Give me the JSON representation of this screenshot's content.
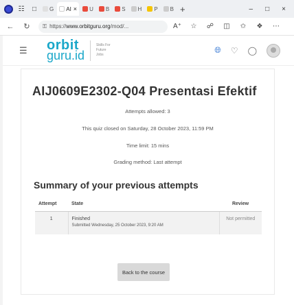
{
  "browser": {
    "tabs": [
      {
        "label": "G",
        "fav_color": "#e0e0e0"
      },
      {
        "label": "AΙ",
        "fav_color": "#ffffff",
        "active": true
      },
      {
        "label": "U",
        "fav_color": "#e94b3c"
      },
      {
        "label": "B",
        "fav_color": "#e94b3c"
      },
      {
        "label": "S",
        "fav_color": "#e94b3c"
      },
      {
        "label": "H",
        "fav_color": "#cccccc"
      },
      {
        "label": "P",
        "fav_color": "#f5c400"
      },
      {
        "label": "B",
        "fav_color": "#cccccc"
      }
    ],
    "close_symbol": "×",
    "new_tab_symbol": "+",
    "url_prefix": "https://",
    "url_host": "www.orbitguru.org",
    "url_rest": "/mod/...",
    "window": {
      "minimize": "–",
      "maximize": "□",
      "close": "×"
    }
  },
  "site": {
    "logo_top": "orbit",
    "logo_bottom": "guru.id",
    "logo_tagline": "Skills For Future Jobs"
  },
  "quiz": {
    "title": "AIJ0609E2302-Q04 Presentasi Efektif",
    "attempts_allowed": "Attempts allowed: 3",
    "closed": "This quiz closed on Saturday, 28 October 2023, 11:59 PM",
    "time_limit": "Time limit: 15 mins",
    "grading_method": "Grading method: Last attempt"
  },
  "summary": {
    "title": "Summary of your previous attempts",
    "headers": {
      "attempt": "Attempt",
      "state": "State",
      "review": "Review"
    },
    "rows": [
      {
        "attempt": "1",
        "state": "Finished",
        "submitted": "Submitted Wednesday, 25 October 2023, 9:20 AM",
        "review": "Not permitted"
      }
    ]
  },
  "back_button": "Back to the course",
  "colors": {
    "brand": "#1aa7c9",
    "accent_blue": "#3a7bd5"
  }
}
